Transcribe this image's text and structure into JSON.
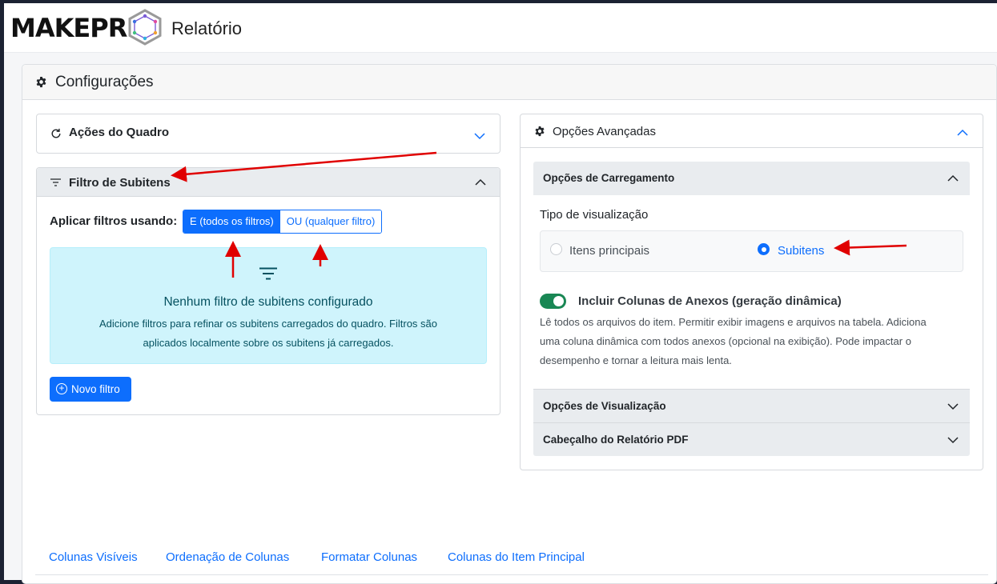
{
  "header": {
    "logo_text": "MAKEPR",
    "app_title": "Relatório"
  },
  "config": {
    "title": "Configurações",
    "left": {
      "acoes": {
        "title": "Ações do Quadro"
      },
      "filtro": {
        "title": "Filtro de Subitens",
        "apply_label": "Aplicar filtros usando:",
        "options": [
          "E (todos os filtros)",
          "OU (qualquer filtro)"
        ],
        "selected": "E (todos os filtros)",
        "empty_title": "Nenhum filtro de subitens configurado",
        "empty_desc": "Adicione filtros para refinar os subitens carregados do quadro. Filtros são aplicados localmente sobre os subitens já carregados.",
        "new_button": "Novo filtro"
      }
    },
    "right": {
      "title": "Opções Avançadas",
      "carregamento": {
        "title": "Opções de Carregamento",
        "tipo_label": "Tipo de visualização",
        "radio_options": [
          "Itens principais",
          "Subitens"
        ],
        "radio_selected": "Subitens",
        "switch_label": "Incluir Colunas de Anexos (geração dinâmica)",
        "switch_on": true,
        "switch_desc": "Lê todos os arquivos do item. Permitir exibir imagens e arquivos na tabela. Adiciona uma coluna dinâmica com todos anexos (opcional na exibição). Pode impactar o desempenho e tornar a leitura mais lenta."
      },
      "visualizacao": {
        "title": "Opções de Visualização"
      },
      "cabecalho": {
        "title": "Cabeçalho do Relatório PDF"
      }
    },
    "tabs": [
      "Colunas Visíveis",
      "Ordenação de Colunas",
      "Formatar Colunas",
      "Colunas do Item Principal"
    ]
  },
  "colors": {
    "primary": "#0d6efd",
    "success": "#198754",
    "info_bg": "#cff4fc",
    "info_text": "#055160",
    "annotation": "#e00000"
  }
}
